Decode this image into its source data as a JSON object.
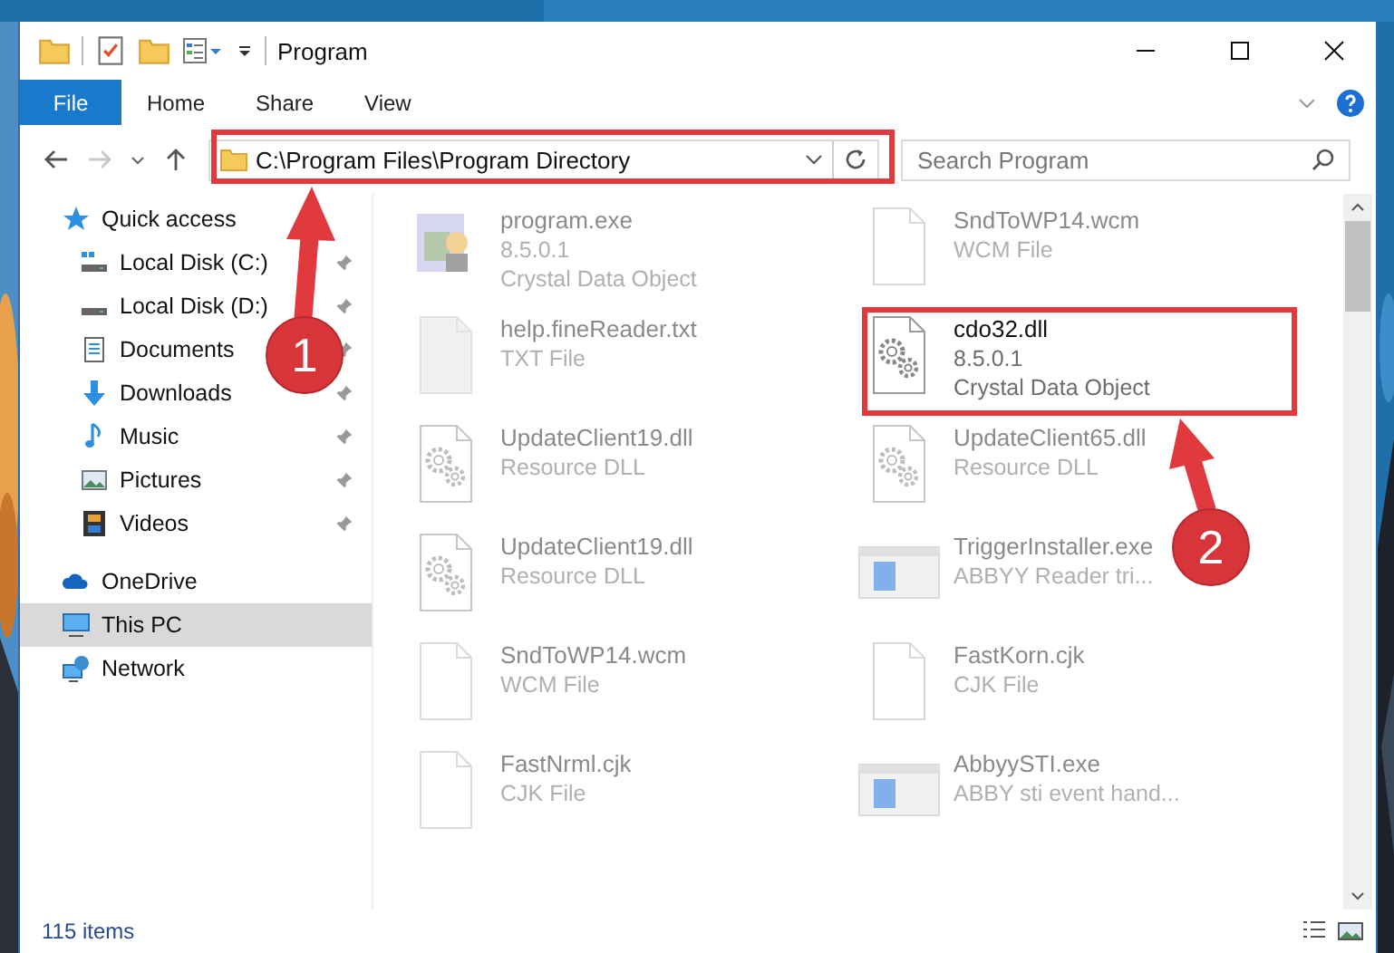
{
  "window": {
    "title": "Program"
  },
  "ribbon": {
    "file_tab": "File",
    "tabs": [
      "Home",
      "Share",
      "View"
    ]
  },
  "address_bar": {
    "path": "C:\\Program Files\\Program Directory",
    "forward_disabled": true
  },
  "search": {
    "placeholder": "Search Program"
  },
  "sidebar": {
    "items": [
      {
        "label": "Quick access",
        "kind": "star",
        "pinned": false,
        "selected": false,
        "indent": false
      },
      {
        "label": "Local Disk (C:)",
        "kind": "drive-c",
        "pinned": true,
        "selected": false,
        "indent": true
      },
      {
        "label": "Local Disk (D:)",
        "kind": "drive",
        "pinned": true,
        "selected": false,
        "indent": true
      },
      {
        "label": "Documents",
        "kind": "document",
        "pinned": true,
        "selected": false,
        "indent": true
      },
      {
        "label": "Downloads",
        "kind": "download",
        "pinned": true,
        "selected": false,
        "indent": true
      },
      {
        "label": "Music",
        "kind": "music",
        "pinned": true,
        "selected": false,
        "indent": true
      },
      {
        "label": "Pictures",
        "kind": "picture",
        "pinned": true,
        "selected": false,
        "indent": true
      },
      {
        "label": "Videos",
        "kind": "video",
        "pinned": true,
        "selected": false,
        "indent": true
      },
      {
        "label": "OneDrive",
        "kind": "cloud",
        "pinned": false,
        "selected": false,
        "indent": false
      },
      {
        "label": "This PC",
        "kind": "computer",
        "pinned": false,
        "selected": true,
        "indent": false
      },
      {
        "label": "Network",
        "kind": "network",
        "pinned": false,
        "selected": false,
        "indent": false
      }
    ]
  },
  "files": [
    {
      "name": "program.exe",
      "details": [
        "8.5.0.1",
        "Crystal Data Object"
      ],
      "kind": "program",
      "faded": true
    },
    {
      "name": "SndToWP14.wcm",
      "details": [
        "WCM File"
      ],
      "kind": "blank",
      "faded": true
    },
    {
      "name": "help.fineReader.txt",
      "details": [
        "TXT File"
      ],
      "kind": "text",
      "faded": true
    },
    {
      "name": "cdo32.dll",
      "details": [
        "8.5.0.1",
        "Crystal Data Object"
      ],
      "kind": "gear",
      "faded": false
    },
    {
      "name": "UpdateClient19.dll",
      "details": [
        "Resource DLL"
      ],
      "kind": "gear",
      "faded": true
    },
    {
      "name": "UpdateClient65.dll",
      "details": [
        "Resource DLL"
      ],
      "kind": "gear",
      "faded": true
    },
    {
      "name": "UpdateClient19.dll",
      "details": [
        "Resource DLL"
      ],
      "kind": "gear",
      "faded": true
    },
    {
      "name": "TriggerInstaller.exe",
      "details": [
        "ABBYY Reader tri..."
      ],
      "kind": "exe",
      "faded": true
    },
    {
      "name": "SndToWP14.wcm",
      "details": [
        "WCM File"
      ],
      "kind": "blank",
      "faded": true
    },
    {
      "name": "FastKorn.cjk",
      "details": [
        "CJK File"
      ],
      "kind": "blank",
      "faded": true
    },
    {
      "name": "FastNrml.cjk",
      "details": [
        "CJK File"
      ],
      "kind": "blank",
      "faded": true
    },
    {
      "name": "AbbyySTI.exe",
      "details": [
        "ABBY sti event hand..."
      ],
      "kind": "exe",
      "faded": true
    }
  ],
  "status_bar": {
    "count": "115 items"
  },
  "annotations": [
    {
      "number": "1"
    },
    {
      "number": "2"
    }
  ]
}
